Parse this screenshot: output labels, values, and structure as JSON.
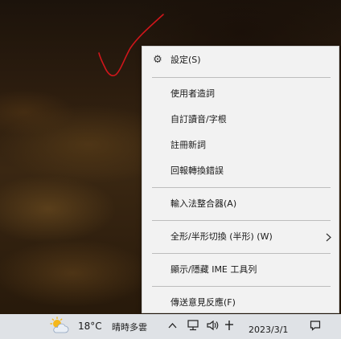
{
  "context_menu": {
    "items": [
      {
        "label": "設定(S)",
        "icon": "gear-icon"
      },
      {
        "label": "使用者造詞"
      },
      {
        "label": "自訂讀音/字根"
      },
      {
        "label": "註冊新詞"
      },
      {
        "label": "回報轉換錯誤"
      },
      {
        "label": "輸入法整合器(A)"
      },
      {
        "label": "全形/半形切換 (半形) (W)",
        "submenu": true
      },
      {
        "label": "顯示/隱藏 IME 工具列"
      },
      {
        "label": "傳送意見反應(F)"
      }
    ]
  },
  "taskbar": {
    "weather": {
      "temperature": "18°C",
      "condition": "晴時多雲",
      "icon": "partly-cloudy-icon"
    },
    "tray_icons": [
      "chevron-up-icon",
      "network-icon",
      "volume-icon",
      "pin-icon"
    ],
    "date": "2023/3/1",
    "notification_icon": "notification-icon"
  },
  "colors": {
    "menu_background": "#f2f2f2",
    "menu_separator": "#bdbdbd",
    "taskbar_background": "#dfe2e6",
    "scribble": "#d0161b"
  }
}
